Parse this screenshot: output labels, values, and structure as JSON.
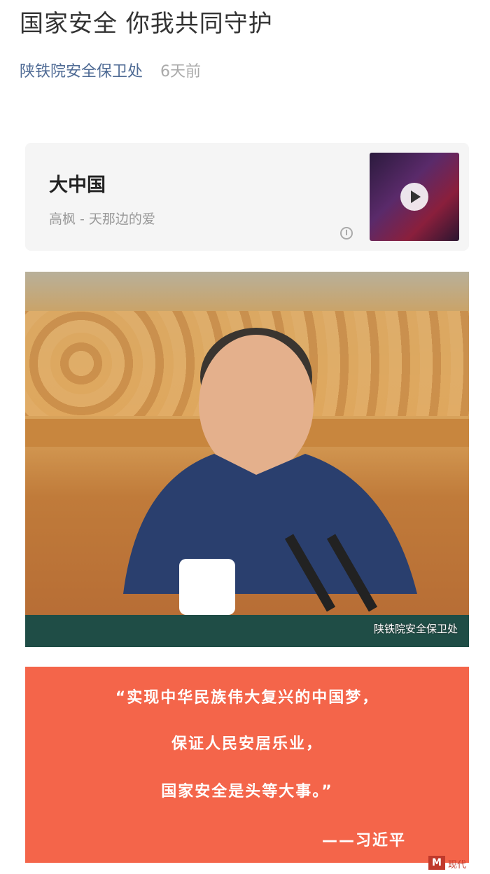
{
  "article": {
    "title": "国家安全 你我共同守护",
    "author": "陕铁院安全保卫处",
    "time": "6天前"
  },
  "music": {
    "song": "大中国",
    "artist": "高枫 - 天那边的爱",
    "cover_icon": "play-icon",
    "source_icon": "music-note-icon"
  },
  "photo": {
    "watermark": "陕铁院安全保卫处"
  },
  "quote": {
    "line1": "“实现中华民族伟大复兴的中国梦，",
    "line2": "保证人民安居乐业，",
    "line3": "国家安全是头等大事。”",
    "source": "——习近平",
    "background": "#f4654a"
  },
  "footer": {
    "logo_text": "M",
    "site_text": "现代"
  }
}
